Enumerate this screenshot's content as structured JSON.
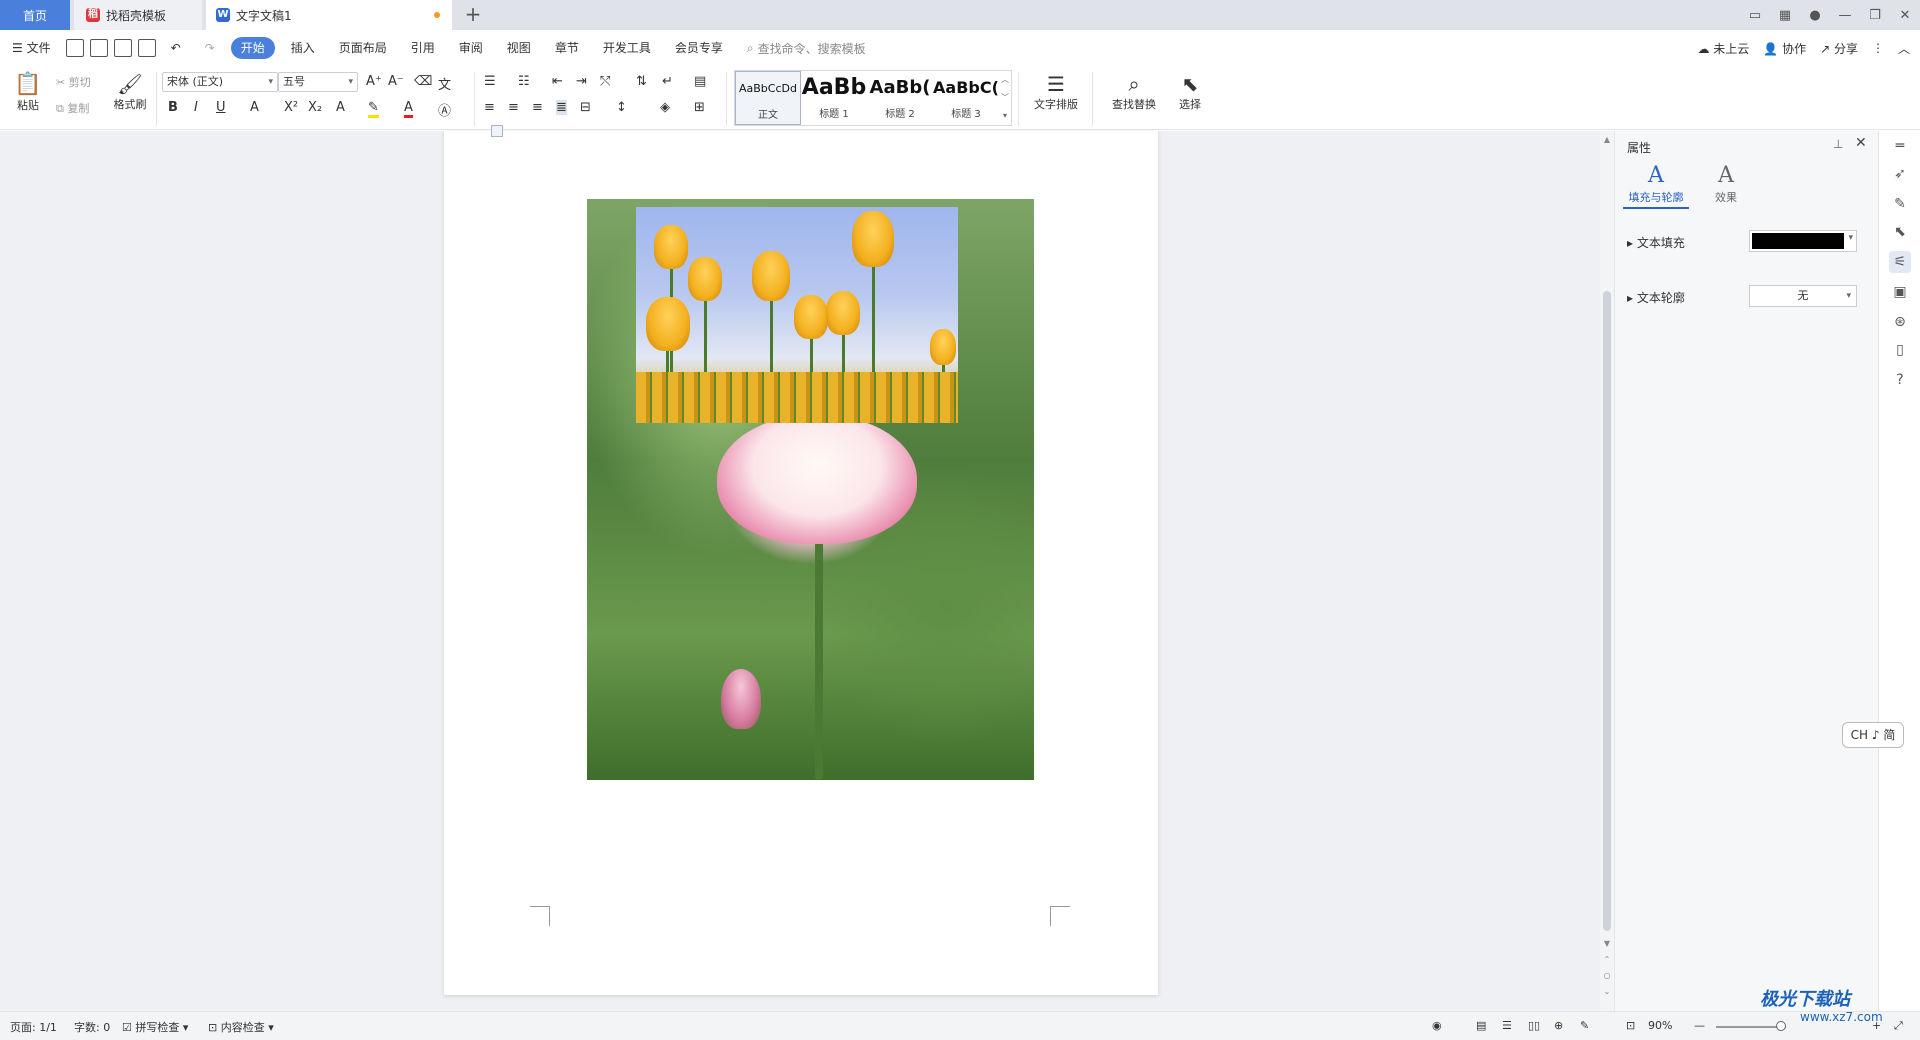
{
  "tabs": {
    "home": "首页",
    "template": "找稻壳模板",
    "doc": "文字文稿1",
    "add": "+"
  },
  "window": {
    "layout_icon": "layout-icon",
    "grid_icon": "grid-icon",
    "minimize": "—",
    "restore": "❐",
    "close": "✕"
  },
  "menu": {
    "file": "文件",
    "items": [
      "开始",
      "插入",
      "页面布局",
      "引用",
      "审阅",
      "视图",
      "章节",
      "开发工具",
      "会员专享"
    ],
    "search": "查找命令、搜索模板",
    "cloud": "未上云",
    "collab": "协作",
    "share": "分享"
  },
  "ribbon": {
    "paste": "粘贴",
    "cut": "剪切",
    "copy": "复制",
    "format_painter": "格式刷",
    "font": "宋体 (正文)",
    "size": "五号",
    "styles": [
      {
        "preview": "AaBbCcDd",
        "name": "正文"
      },
      {
        "preview": "AaBb",
        "name": "标题 1"
      },
      {
        "preview": "AaBb(",
        "name": "标题 2"
      },
      {
        "preview": "AaBbC(",
        "name": "标题 3"
      }
    ],
    "text_layout": "文字排版",
    "find_replace": "查找替换",
    "select": "选择"
  },
  "pane": {
    "title": "属性",
    "tab_fill": "填充与轮廓",
    "tab_effect": "效果",
    "text_fill": "文本填充",
    "text_outline": "文本轮廓",
    "outline_value": "无",
    "fill_color": "#000000"
  },
  "ime": "CH ♪ 简",
  "status": {
    "page": "页面: 1/1",
    "words": "字数: 0",
    "spell": "拼写检查",
    "content": "内容检查",
    "zoom": "90%"
  },
  "watermark": {
    "brand": "极光下载站",
    "url": "www.xz7.com"
  }
}
